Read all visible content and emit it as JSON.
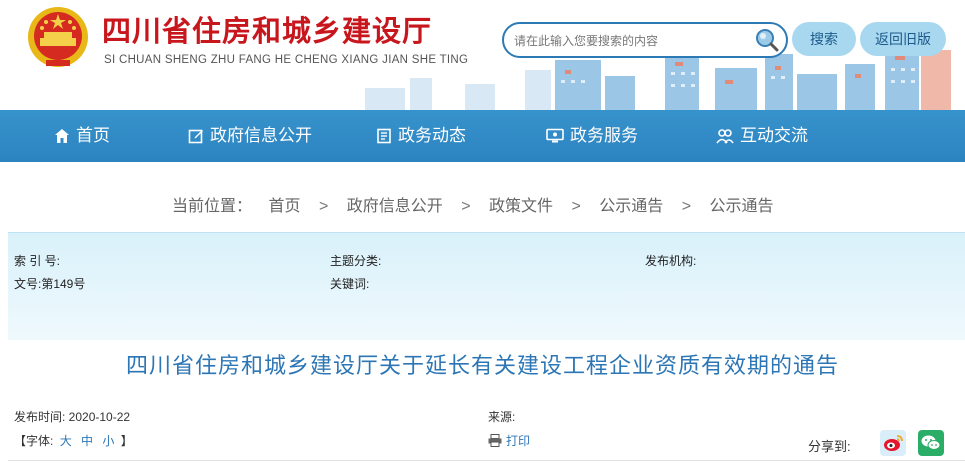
{
  "header": {
    "title": "四川省住房和城乡建设厅",
    "subtitle": "SI CHUAN SHENG ZHU FANG HE CHENG XIANG JIAN SHE TING",
    "search_placeholder": "请在此输入您要搜索的内容",
    "search_button": "搜索",
    "old_version_button": "返回旧版",
    "icons": [
      "emblem",
      "search-icon"
    ],
    "colors": {
      "title": "#c8161d",
      "accent": "#2c83c0",
      "button_bg": "#a8d8ef"
    }
  },
  "nav": {
    "items": [
      {
        "label": "首页",
        "icon": "home-icon"
      },
      {
        "label": "政府信息公开",
        "icon": "edit-icon"
      },
      {
        "label": "政务动态",
        "icon": "document-icon"
      },
      {
        "label": "政务服务",
        "icon": "monitor-icon"
      },
      {
        "label": "互动交流",
        "icon": "people-icon"
      }
    ]
  },
  "breadcrumb": {
    "prefix": "当前位置：",
    "items": [
      "首页",
      "政府信息公开",
      "政策文件",
      "公示通告",
      "公示通告"
    ],
    "separator": ">"
  },
  "info": {
    "index_label": "索 引 号:",
    "index_value": "",
    "topic_label": "主题分类:",
    "topic_value": "",
    "issuer_label": "发布机构:",
    "issuer_value": "",
    "doc_no": "文号:第149号",
    "keywords_label": "关键词:",
    "keywords_value": ""
  },
  "article": {
    "title": "四川省住房和城乡建设厅关于延长有关建设工程企业资质有效期的通告",
    "publish_time": "发布时间: 2020-10-22",
    "source_label": "来源:",
    "font_size_label": "【字体:",
    "font_sizes": [
      "大",
      "中",
      "小"
    ],
    "font_size_close": "】",
    "print_label": "打印",
    "share_label": "分享到:",
    "share_icons": [
      "weibo-icon",
      "wechat-icon"
    ]
  }
}
